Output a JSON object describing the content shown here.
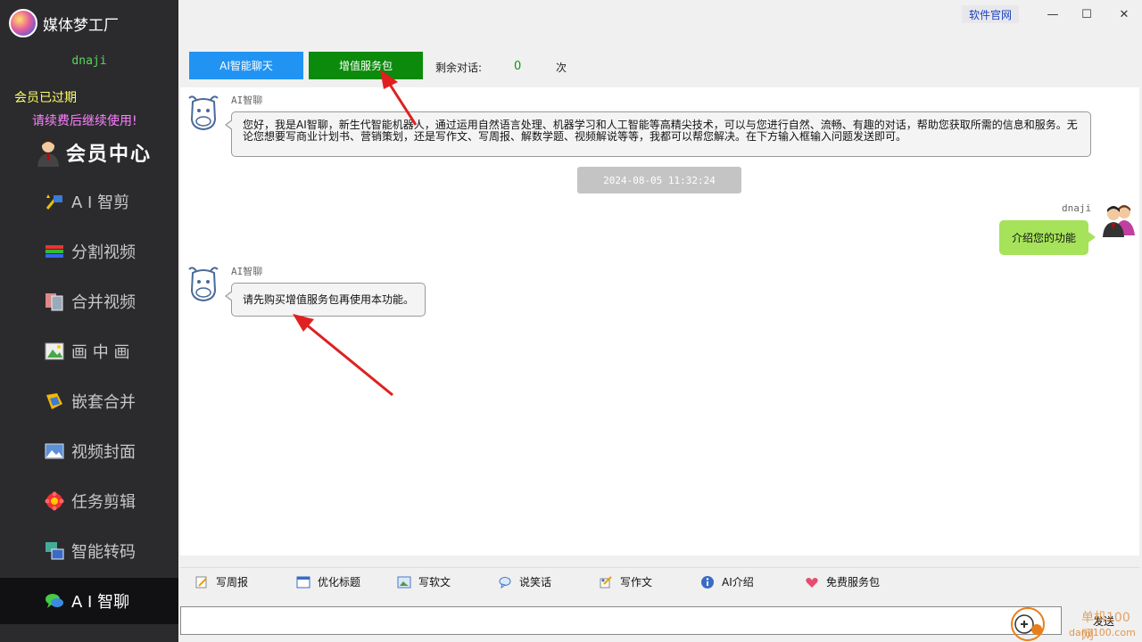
{
  "app": {
    "name": "媒体梦工厂"
  },
  "window": {
    "website_label": "软件官网",
    "minimize": "—",
    "maximize": "☐",
    "close": "✕"
  },
  "sidebar": {
    "username": "dnaji",
    "member_status": "会员已过期",
    "renew_note": "请续费后继续使用!",
    "member_center": "会员中心",
    "items": [
      {
        "label": "A I 智剪",
        "icon": "ai-cut-icon"
      },
      {
        "label": "分割视频",
        "icon": "split-video-icon"
      },
      {
        "label": "合并视频",
        "icon": "merge-video-icon"
      },
      {
        "label": "画 中 画",
        "icon": "picture-in-picture-icon"
      },
      {
        "label": "嵌套合并",
        "icon": "nested-merge-icon"
      },
      {
        "label": "视频封面",
        "icon": "video-cover-icon"
      },
      {
        "label": "任务剪辑",
        "icon": "task-edit-icon"
      },
      {
        "label": "智能转码",
        "icon": "smart-transcode-icon"
      },
      {
        "label": "A I 智聊",
        "icon": "ai-chat-icon",
        "active": true
      }
    ]
  },
  "toolbar": {
    "ai_chat_tab": "AI智能聊天",
    "value_pack": "增值服务包",
    "remaining_label": "剩余对话:",
    "remaining_count": "0",
    "remaining_unit": "次"
  },
  "chat": {
    "messages": [
      {
        "sender": "AI智聊",
        "line1": "您好，我是AI智聊，新生代智能机器人，通过运用自然语言处理、机器学习和人工智能等高精尖技术，可以与您进行自然、流畅、有趣的对话，帮助您获取所需的信息和服务。无",
        "line2": "论您想要写商业计划书、营销策划，还是写作文、写周报、解数学题、视频解说等等，我都可以帮您解决。在下方输入框输入问题发送即可。"
      },
      {
        "timestamp": "2024-08-05 11:32:24"
      },
      {
        "sender": "dnaji",
        "text": "介绍您的功能"
      },
      {
        "sender": "AI智聊",
        "text": "请先购买增值服务包再使用本功能。"
      }
    ]
  },
  "quick_actions": [
    {
      "label": "写周报",
      "icon": "weekly-report-icon"
    },
    {
      "label": "优化标题",
      "icon": "optimize-title-icon"
    },
    {
      "label": "写软文",
      "icon": "soft-article-icon"
    },
    {
      "label": "说笑话",
      "icon": "joke-icon"
    },
    {
      "label": "写作文",
      "icon": "essay-icon"
    },
    {
      "label": "AI介绍",
      "icon": "info-icon"
    },
    {
      "label": "免费服务包",
      "icon": "heart-icon"
    }
  ],
  "input": {
    "value": "",
    "send_label": "发送"
  },
  "watermark": {
    "text": "单机100网",
    "url": "danji100.com"
  },
  "colors": {
    "sidebar_bg": "#2b2b2e",
    "tab_blue": "#2194f3",
    "pack_green": "#0c8a0c",
    "user_bubble": "#a6e35a",
    "arrow_red": "#e02020"
  }
}
